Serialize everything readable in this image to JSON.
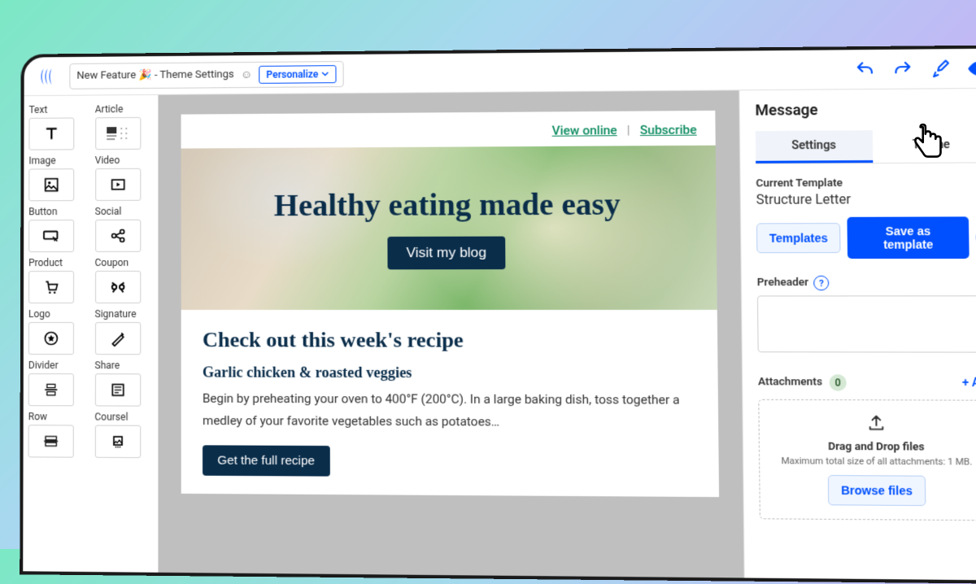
{
  "topbar": {
    "subject": "New Feature 🎉 - Theme Settings",
    "personalize": "Personalize"
  },
  "blocks": [
    {
      "label": "Text",
      "icon": "text"
    },
    {
      "label": "Article",
      "icon": "article"
    },
    {
      "label": "Image",
      "icon": "image"
    },
    {
      "label": "Video",
      "icon": "video"
    },
    {
      "label": "Button",
      "icon": "button"
    },
    {
      "label": "Social",
      "icon": "social"
    },
    {
      "label": "Product",
      "icon": "product"
    },
    {
      "label": "Coupon",
      "icon": "coupon"
    },
    {
      "label": "Logo",
      "icon": "logo"
    },
    {
      "label": "Signature",
      "icon": "signature"
    },
    {
      "label": "Divider",
      "icon": "divider"
    },
    {
      "label": "Share",
      "icon": "share"
    },
    {
      "label": "Row",
      "icon": "row"
    },
    {
      "label": "Coursel",
      "icon": "carousel"
    }
  ],
  "email": {
    "view_online": "View online",
    "subscribe": "Subscribe",
    "hero_title": "Healthy eating made easy",
    "hero_btn": "Visit my blog",
    "section_title": "Check out this week's recipe",
    "recipe_title": "Garlic chicken & roasted veggies",
    "recipe_body": "Begin by preheating your oven to 400°F (200°C). In a large baking dish, toss together a medley of your favorite vegetables such as potatoes…",
    "recipe_btn": "Get the full recipe"
  },
  "side": {
    "title": "Message",
    "tab_settings": "Settings",
    "tab_theme": "Theme",
    "current_template_label": "Current Template",
    "current_template": "Structure Letter",
    "templates_btn": "Templates",
    "save_template_btn": "Save as template",
    "preheader_label": "Preheader",
    "attachments_label": "Attachments",
    "attachments_count": "0",
    "add_label": "+ Add",
    "dropzone_title": "Drag and Drop files",
    "dropzone_sub": "Maximum total size of all attachments: 1 MB.",
    "browse_btn": "Browse files"
  }
}
